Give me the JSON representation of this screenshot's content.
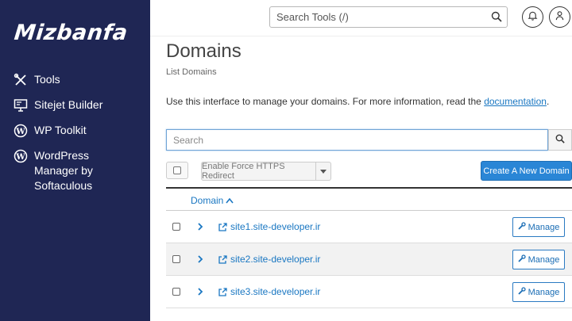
{
  "brand": {
    "logo_text": "Mizbanfa"
  },
  "sidebar": {
    "items": [
      {
        "label": "Tools",
        "icon": "tools-icon"
      },
      {
        "label": "Sitejet Builder",
        "icon": "monitor-icon"
      },
      {
        "label": "WP Toolkit",
        "icon": "wordpress-icon"
      },
      {
        "label": "WordPress\nManager by\nSoftaculous",
        "icon": "wordpress-icon"
      }
    ]
  },
  "header": {
    "search_placeholder": "Search Tools (/)"
  },
  "page": {
    "title": "Domains",
    "subtitle": "List Domains",
    "intro_text": "Use this interface to manage your domains. For more information, read the ",
    "intro_link": "documentation",
    "intro_end": "."
  },
  "search": {
    "placeholder": "Search"
  },
  "toolbar": {
    "https_label": "Enable Force HTTPS Redirect",
    "create_label": "Create A New Domain"
  },
  "table": {
    "column_domain": "Domain",
    "rows": [
      {
        "domain": "site1.site-developer.ir",
        "action": "Manage"
      },
      {
        "domain": "site2.site-developer.ir",
        "action": "Manage"
      },
      {
        "domain": "site3.site-developer.ir",
        "action": "Manage"
      }
    ]
  },
  "colors": {
    "sidebar_bg": "#1f2654",
    "accent": "#2a86d6",
    "link": "#1a77c2"
  }
}
